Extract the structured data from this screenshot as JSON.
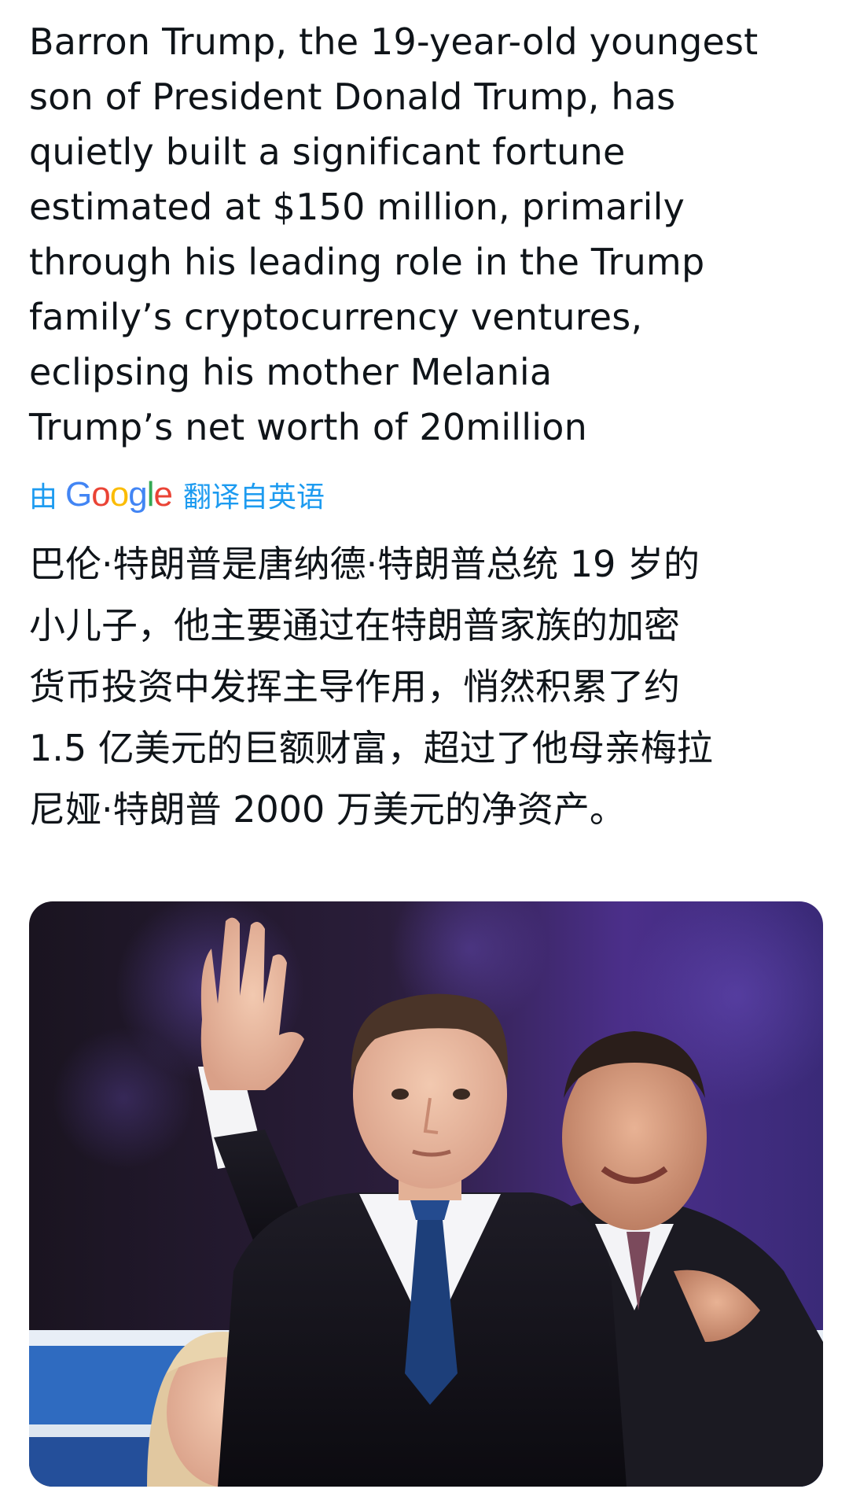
{
  "post": {
    "text": "Barron Trump, the 19-year-old youngest\nson of President Donald Trump, has\nquietly built a significant fortune\nestimated at $150 million, primarily\nthrough his leading role in the Trump\nfamily’s cryptocurrency ventures,\neclipsing his mother Melania\nTrump’s net worth of 20million",
    "translation": {
      "by_label": "由",
      "provider_logo_text": "Google",
      "from_label": "翻译自英语",
      "text": "巴伦·特朗普是唐纳德·特朗普总统 19 岁的\n小儿子，他主要通过在特朗普家族的加密\n货币投资中发挥主导作用，悄然积累了约\n1.5 亿美元的巨额财富，超过了他母亲梅拉\n尼娅·特朗普 2000 万美元的净资产。"
    }
  },
  "colors": {
    "text": "#0f1419",
    "link_blue": "#1d9bf0",
    "background": "#ffffff"
  }
}
